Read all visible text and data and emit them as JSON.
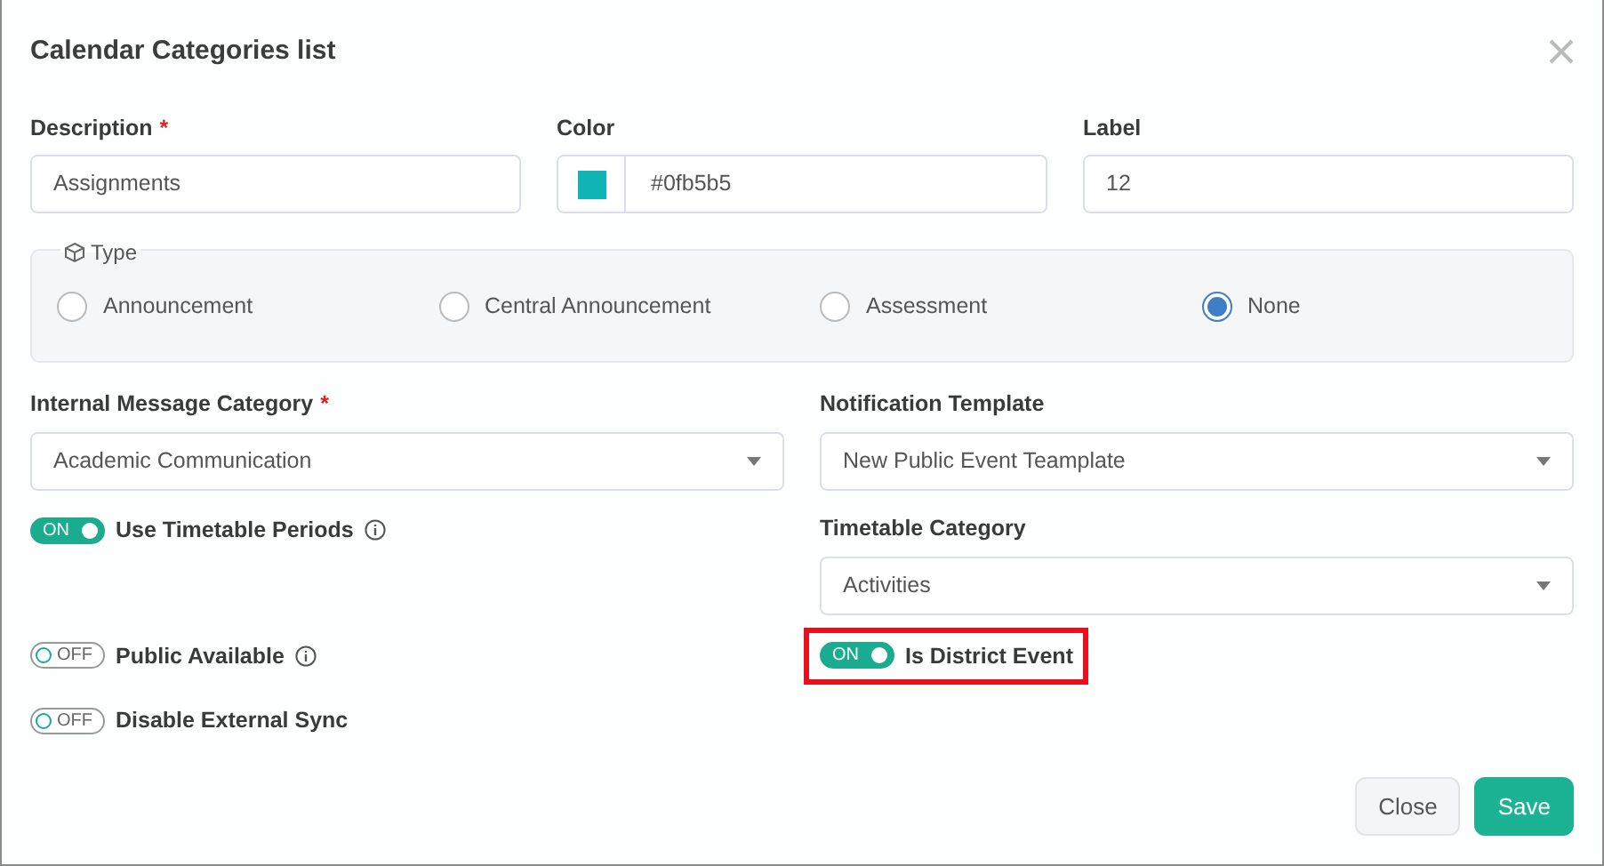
{
  "dialog": {
    "title": "Calendar Categories list"
  },
  "fields": [
    {
      "label": "Description",
      "required_mark": "*",
      "value": "Assignments",
      "kind": "text"
    },
    {
      "label": "Color",
      "value": "#0fb5b5",
      "kind": "color",
      "color": "#0fb5b5"
    },
    {
      "label": "Label",
      "value": "12",
      "kind": "text"
    }
  ],
  "type_group": {
    "legend": "Type",
    "options": [
      {
        "label": "Announcement",
        "selected": false
      },
      {
        "label": "Central Announcement",
        "selected": false
      },
      {
        "label": "Assessment",
        "selected": false
      },
      {
        "label": "None",
        "selected": true
      }
    ]
  },
  "internal_message_category": {
    "label": "Internal Message Category",
    "required_mark": "*",
    "value": "Academic Communication"
  },
  "notification_template": {
    "label": "Notification Template",
    "value": "New Public Event Teamplate"
  },
  "timetable_category": {
    "label": "Timetable Category",
    "value": "Activities"
  },
  "toggles": [
    {
      "label": "Use Timetable Periods",
      "on": true,
      "info": true,
      "highlighted": false,
      "state_text": "ON"
    },
    {
      "label": "Public Available",
      "on": false,
      "info": true,
      "highlighted": false,
      "state_text": "OFF"
    },
    {
      "label": "Is District Event",
      "on": true,
      "info": false,
      "highlighted": true,
      "state_text": "ON"
    },
    {
      "label": "Disable External Sync",
      "on": false,
      "info": false,
      "highlighted": false,
      "state_text": "OFF"
    }
  ],
  "buttons": [
    {
      "label": "Close",
      "kind": "secondary"
    },
    {
      "label": "Save",
      "kind": "primary"
    }
  ]
}
